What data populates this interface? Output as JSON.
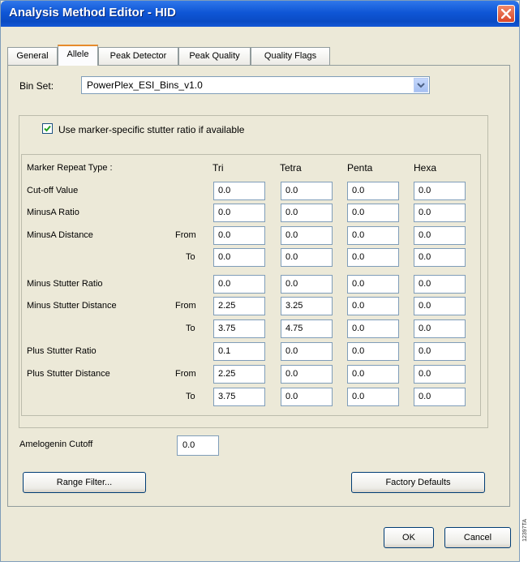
{
  "window": {
    "title": "Analysis Method Editor - HID"
  },
  "tabs": [
    {
      "label": "General"
    },
    {
      "label": "Allele"
    },
    {
      "label": "Peak Detector"
    },
    {
      "label": "Peak Quality"
    },
    {
      "label": "Quality Flags"
    }
  ],
  "active_tab": "Allele",
  "bin_set": {
    "label": "Bin Set:",
    "value": "PowerPlex_ESI_Bins_v1.0"
  },
  "stutter": {
    "checkbox_label": "Use marker-specific stutter ratio if available",
    "checked": true
  },
  "table": {
    "header_label": "Marker Repeat Type :",
    "columns": [
      "Tri",
      "Tetra",
      "Penta",
      "Hexa"
    ],
    "rows": [
      {
        "label": "Cut-off Value",
        "sub": "",
        "values": [
          "0.0",
          "0.0",
          "0.0",
          "0.0"
        ]
      },
      {
        "label": "MinusA Ratio",
        "sub": "",
        "values": [
          "0.0",
          "0.0",
          "0.0",
          "0.0"
        ]
      },
      {
        "label": "MinusA Distance",
        "sub": "From",
        "values": [
          "0.0",
          "0.0",
          "0.0",
          "0.0"
        ]
      },
      {
        "label": "",
        "sub": "To",
        "values": [
          "0.0",
          "0.0",
          "0.0",
          "0.0"
        ]
      },
      {
        "label": "Minus Stutter Ratio",
        "sub": "",
        "values": [
          "0.0",
          "0.0",
          "0.0",
          "0.0"
        ]
      },
      {
        "label": "Minus Stutter Distance",
        "sub": "From",
        "values": [
          "2.25",
          "3.25",
          "0.0",
          "0.0"
        ]
      },
      {
        "label": "",
        "sub": "To",
        "values": [
          "3.75",
          "4.75",
          "0.0",
          "0.0"
        ]
      },
      {
        "label": "Plus Stutter Ratio",
        "sub": "",
        "values": [
          "0.1",
          "0.0",
          "0.0",
          "0.0"
        ]
      },
      {
        "label": "Plus Stutter Distance",
        "sub": "From",
        "values": [
          "2.25",
          "0.0",
          "0.0",
          "0.0"
        ]
      },
      {
        "label": "",
        "sub": "To",
        "values": [
          "3.75",
          "0.0",
          "0.0",
          "0.0"
        ]
      }
    ]
  },
  "amelogenin": {
    "label": "Amelogenin Cutoff",
    "value": "0.0"
  },
  "buttons": {
    "range_filter": "Range Filter...",
    "factory_defaults": "Factory Defaults",
    "ok": "OK",
    "cancel": "Cancel"
  },
  "side_id": "12397TA",
  "icons": {
    "close": "close-icon",
    "dropdown": "chevron-down-icon",
    "checkbox": "checkmark-icon"
  },
  "colors": {
    "titlebar": "#0a4bc4",
    "dialog_bg": "#ece9d8",
    "close_button": "#d9472a",
    "active_tab_accent": "#e68b2c",
    "checkmark": "#21a121"
  }
}
